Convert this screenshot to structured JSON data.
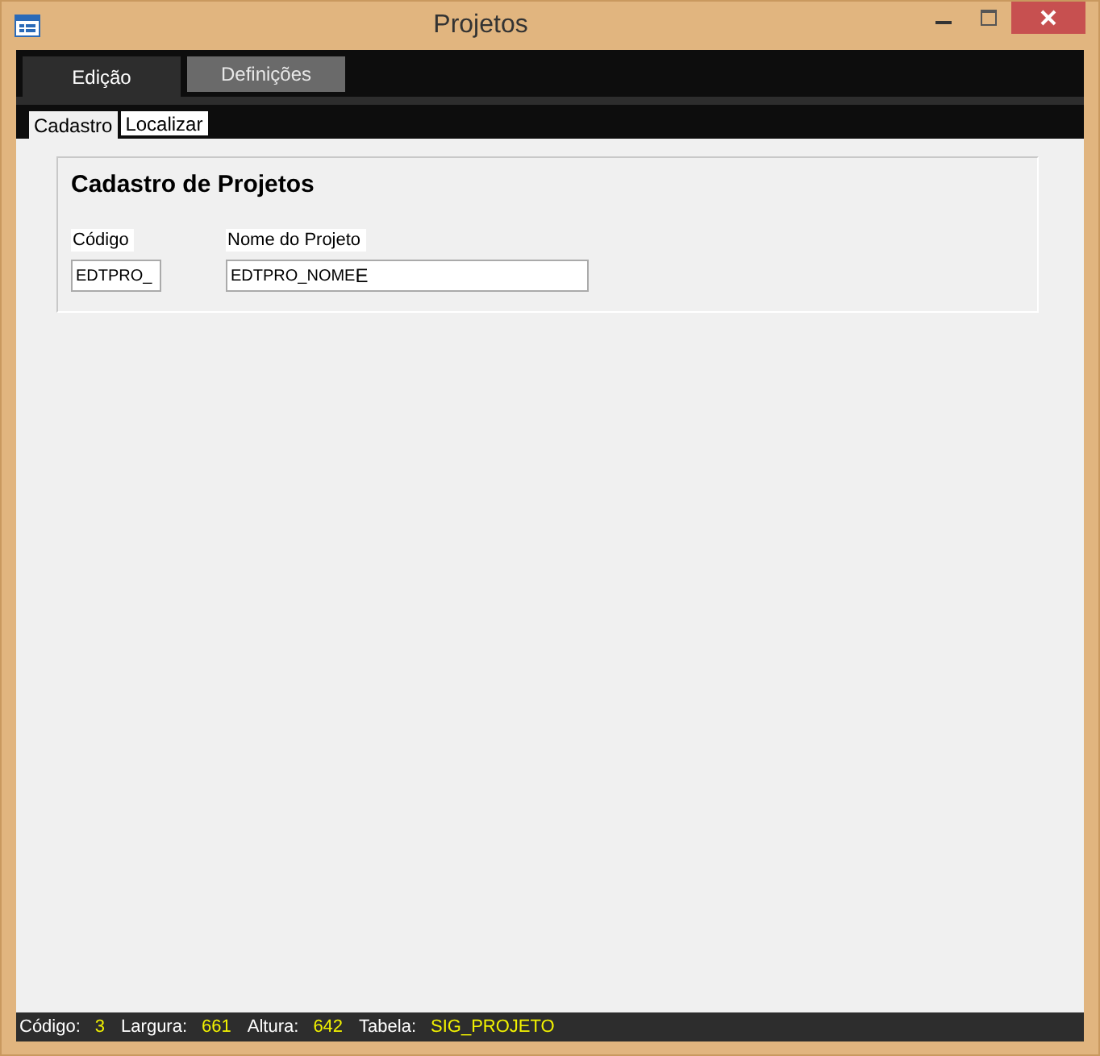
{
  "window": {
    "title": "Projetos"
  },
  "tabs": [
    {
      "label": "Edição",
      "selected": true
    },
    {
      "label": "Definições",
      "selected": false
    }
  ],
  "subtabs": [
    {
      "label": "Cadastro",
      "selected": true
    },
    {
      "label": "Localizar",
      "selected": false
    }
  ],
  "group": {
    "title": "Cadastro de Projetos",
    "fields": [
      {
        "label": "Código",
        "name": "EDTPRO_"
      },
      {
        "label": "Nome do Projeto",
        "name": "EDTPRO_NOME",
        "value": "E"
      }
    ]
  },
  "status_bar": [
    {
      "label": "Código:",
      "value": "3"
    },
    {
      "label": "Largura:",
      "value": "661"
    },
    {
      "label": "Altura:",
      "value": "642"
    },
    {
      "label": "Tabela:",
      "value": "SIG_PROJETO"
    }
  ]
}
